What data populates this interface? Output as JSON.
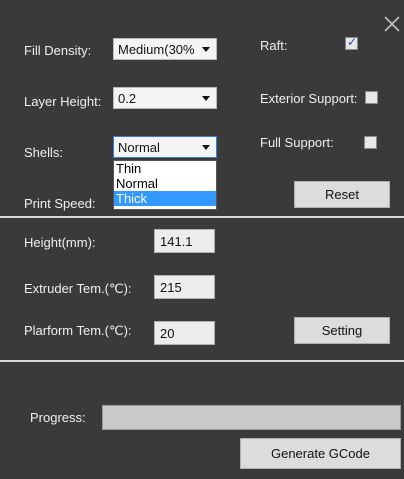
{
  "settings": {
    "fill_density": {
      "label": "Fill Density:",
      "value": "Medium(30%"
    },
    "layer_height": {
      "label": "Layer Height:",
      "value": "0.2"
    },
    "shells": {
      "label": "Shells:",
      "value": "Normal",
      "options": [
        "Thin",
        "Normal",
        "Thick"
      ],
      "highlighted": "Thick"
    },
    "print_speed": {
      "label": "Print Speed:"
    },
    "raft": {
      "label": "Raft:",
      "checked": true
    },
    "exterior_support": {
      "label": "Exterior Support:",
      "checked": false
    },
    "full_support": {
      "label": "Full Support:",
      "checked": false
    },
    "reset_label": "Reset"
  },
  "temps": {
    "height": {
      "label": "Height(mm):",
      "value": "141.1"
    },
    "extruder": {
      "label": "Extruder Tem.(℃):",
      "value": "215"
    },
    "platform": {
      "label": "Plarform Tem.(℃):",
      "value": "20"
    },
    "setting_label": "Setting"
  },
  "footer": {
    "progress_label": "Progress:",
    "progress": 0,
    "generate_label": "Generate GCode"
  },
  "icons": {
    "close": "close-icon",
    "check": "checkmark-icon"
  }
}
